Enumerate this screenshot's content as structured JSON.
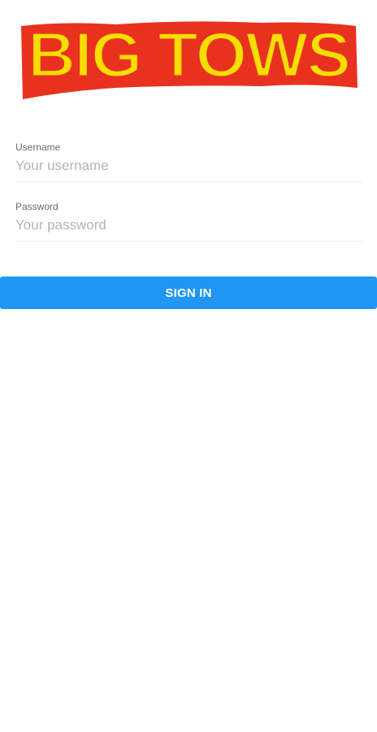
{
  "brand": {
    "logo_text": "BIG TOWS",
    "colors": {
      "fill": "#f7dd00",
      "outline": "#e8321f"
    }
  },
  "form": {
    "username": {
      "label": "Username",
      "placeholder": "Your username",
      "value": ""
    },
    "password": {
      "label": "Password",
      "placeholder": "Your password",
      "value": ""
    },
    "submit_label": "SIGN IN"
  },
  "theme": {
    "primary": "#2196f3",
    "background": "#ffffff"
  }
}
